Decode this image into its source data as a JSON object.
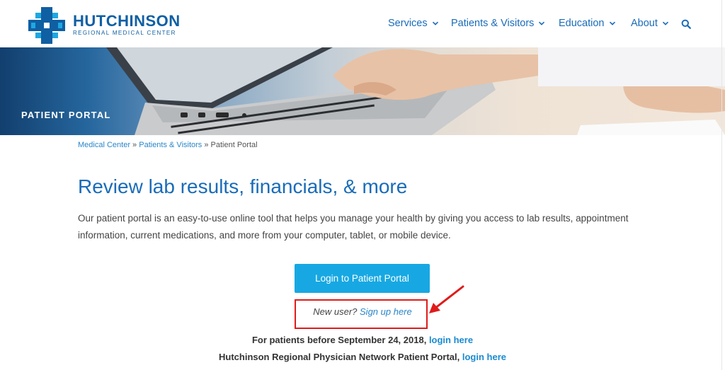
{
  "brand": {
    "name": "HUTCHINSON",
    "sub": "REGIONAL MEDICAL CENTER"
  },
  "nav": [
    {
      "label": "Services",
      "icon": "chevron-down-icon"
    },
    {
      "label": "Patients & Visitors",
      "icon": "chevron-down-icon"
    },
    {
      "label": "Education",
      "icon": "chevron-down-icon"
    },
    {
      "label": "About",
      "icon": "chevron-down-icon"
    }
  ],
  "search_icon": "search-icon",
  "hero": {
    "title": "PATIENT PORTAL"
  },
  "breadcrumb": {
    "items": [
      "Medical Center",
      "Patients & Visitors"
    ],
    "separator": "»",
    "current": "Patient Portal"
  },
  "main": {
    "headline": "Review lab results, financials, & more",
    "body": "Our patient portal is an easy-to-use online tool that helps you manage your health by giving you access to lab results, appointment information, current medications, and more from your computer, tablet, or mobile device.",
    "login_button": "Login to Patient Portal",
    "new_user_prefix": "New user?",
    "sign_up": "Sign up here",
    "older_patients_prefix": "For patients before September 24, 2018,",
    "older_patients_link": "login here",
    "physician_prefix": "Hutchinson Regional Physician Network Patient Portal,",
    "physician_link": "login here"
  },
  "colors": {
    "brand": "#0f5fa3",
    "nav": "#1a6cb8",
    "button": "#17a8e3",
    "link": "#2a86c8",
    "annotation": "#e01b1b"
  }
}
